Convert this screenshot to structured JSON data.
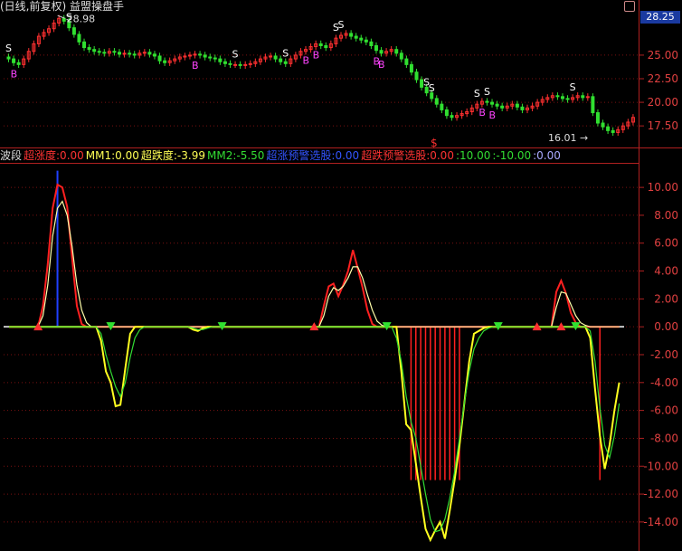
{
  "window": {
    "title": "(日线,前复权) 益盟操盘手",
    "current_price": "28.25",
    "upper_annotations": {
      "high_price": "28.98",
      "low_price": "16.01 →",
      "red_marker": "$"
    },
    "lower_labels": [
      {
        "text": "波段",
        "color": "#dddddd"
      },
      {
        "text": "超涨度:0.00",
        "color": "#ff3333"
      },
      {
        "text": "MM1:0.00",
        "color": "#ffff55"
      },
      {
        "text": "超跌度:-3.99",
        "color": "#ffff55"
      },
      {
        "text": "MM2:-5.50",
        "color": "#33dd33"
      },
      {
        "text": "超涨预警选股:0.00",
        "color": "#3355ff"
      },
      {
        "text": "超跌预警选股:0.00",
        "color": "#ff3333"
      },
      {
        "text": ":10.00",
        "color": "#33dd33"
      },
      {
        "text": ":-10.00",
        "color": "#33dd33"
      },
      {
        "text": ":0.00",
        "color": "#aaaaff"
      }
    ]
  },
  "chart_data": [
    {
      "type": "candlestick",
      "title": "(日线,前复权) 益盟操盘手",
      "y_ticks": [
        "25.00",
        "22.50",
        "20.00",
        "17.50"
      ],
      "ylim": [
        15.5,
        29.5
      ],
      "closes": [
        24.6,
        24.2,
        24.0,
        24.6,
        25.4,
        26.2,
        27.0,
        27.4,
        27.8,
        28.4,
        28.9,
        28.6,
        27.9,
        27.2,
        26.4,
        25.8,
        25.6,
        25.4,
        25.3,
        25.2,
        25.4,
        25.3,
        25.1,
        25.2,
        25.1,
        25.0,
        25.2,
        25.3,
        25.1,
        24.9,
        24.4,
        24.2,
        24.4,
        24.6,
        24.8,
        24.9,
        25.0,
        25.1,
        25.0,
        24.8,
        24.7,
        24.6,
        24.3,
        24.1,
        24.0,
        24.0,
        23.9,
        24.0,
        24.1,
        24.3,
        24.6,
        24.8,
        24.9,
        24.6,
        24.3,
        24.1,
        24.6,
        25.0,
        25.4,
        25.6,
        25.9,
        26.2,
        26.0,
        25.8,
        26.2,
        26.8,
        27.1,
        27.3,
        27.0,
        26.8,
        26.6,
        26.4,
        26.0,
        25.5,
        25.2,
        25.4,
        25.6,
        25.2,
        24.6,
        24.0,
        23.2,
        22.4,
        21.6,
        21.0,
        20.4,
        19.8,
        19.2,
        18.6,
        18.4,
        18.6,
        18.8,
        19.0,
        19.4,
        19.8,
        20.1,
        20.0,
        19.8,
        19.6,
        19.4,
        19.6,
        19.8,
        19.5,
        19.2,
        19.4,
        19.6,
        20.0,
        20.3,
        20.5,
        20.7,
        20.6,
        20.4,
        20.3,
        20.5,
        20.7,
        20.5,
        20.6,
        18.9,
        17.8,
        17.4,
        17.0,
        16.8,
        17.1,
        17.5,
        17.9,
        18.4
      ],
      "signals_S": [
        "S",
        "S",
        "S",
        "S",
        "S",
        "S",
        "S",
        "S",
        "S",
        "S",
        "S"
      ],
      "signals_B": [
        "B",
        "B",
        "B",
        "B",
        "B",
        "B",
        "B",
        "B"
      ]
    },
    {
      "type": "line",
      "title": "波段",
      "y_ticks": [
        "10.00",
        "8.00",
        "6.00",
        "4.00",
        "2.00",
        "0.00",
        "-2.00",
        "-4.00",
        "-6.00",
        "-8.00",
        "-10.00",
        "-12.00",
        "-14.00"
      ],
      "ylim": [
        -15.5,
        11.5
      ],
      "series": [
        {
          "name": "超涨度",
          "color": "#ff2020",
          "values": [
            0,
            0,
            0,
            0,
            0,
            0,
            0,
            1.5,
            4.5,
            8.5,
            10.2,
            10.0,
            8.6,
            5.0,
            1.5,
            0.2,
            0,
            0,
            0,
            0,
            0,
            0,
            0,
            0,
            0,
            0,
            0,
            0,
            0,
            0,
            0,
            0,
            0,
            0,
            0,
            0,
            0,
            0,
            0,
            0,
            0,
            0,
            0,
            0,
            0,
            0,
            0,
            0,
            0,
            0,
            0,
            0,
            0,
            0,
            0,
            0,
            0,
            0,
            0,
            0,
            0,
            0,
            0,
            0,
            0,
            1.5,
            2.9,
            3.1,
            2.2,
            3.0,
            4.0,
            5.5,
            4.2,
            2.8,
            1.2,
            0.2,
            0,
            0,
            0,
            0,
            0,
            0,
            0,
            0,
            0,
            0,
            0,
            0,
            0,
            0,
            0,
            0,
            0,
            0,
            0,
            0,
            0,
            0,
            0,
            0,
            0,
            0,
            0,
            0,
            0,
            0,
            0,
            0,
            0,
            0,
            0,
            0,
            0,
            2.5,
            3.3,
            2.4,
            1.0,
            0.3,
            0,
            0,
            0,
            0,
            0,
            0,
            0,
            0,
            0
          ]
        },
        {
          "name": "MM1",
          "color": "#ffffaa",
          "values": [
            0,
            0,
            0,
            0,
            0,
            0,
            0,
            0.8,
            3.0,
            6.5,
            8.5,
            9.0,
            8.0,
            5.8,
            3.0,
            1.2,
            0.3,
            0,
            0,
            0,
            0,
            0,
            0,
            0,
            0,
            0,
            0,
            0,
            0,
            0,
            0,
            0,
            0,
            0,
            0,
            0,
            0,
            0,
            0,
            0,
            0,
            0,
            0,
            0,
            0,
            0,
            0,
            0,
            0,
            0,
            0,
            0,
            0,
            0,
            0,
            0,
            0,
            0,
            0,
            0,
            0,
            0,
            0,
            0,
            0,
            0.8,
            2.2,
            2.8,
            2.6,
            2.9,
            3.5,
            4.3,
            4.3,
            3.5,
            2.3,
            1.2,
            0.4,
            0.1,
            0,
            0,
            0,
            0,
            0,
            0,
            0,
            0,
            0,
            0,
            0,
            0,
            0,
            0,
            0,
            0,
            0,
            0,
            0,
            0,
            0,
            0,
            0,
            0,
            0,
            0,
            0,
            0,
            0,
            0,
            0,
            0,
            0,
            0,
            0,
            1.4,
            2.5,
            2.4,
            1.6,
            0.8,
            0.3,
            0.1,
            0,
            0,
            0,
            0,
            0,
            0,
            0
          ]
        },
        {
          "name": "超跌度",
          "color": "#ffff20",
          "values": [
            0,
            0,
            0,
            0,
            0,
            0,
            0,
            0,
            0,
            0,
            0,
            0,
            0,
            0,
            0,
            0,
            0,
            0,
            0,
            -1.0,
            -3.2,
            -4.0,
            -5.7,
            -5.6,
            -3.0,
            -0.5,
            0,
            0,
            0,
            0,
            0,
            0,
            0,
            0,
            0,
            0,
            0,
            0,
            -0.2,
            -0.3,
            -0.1,
            0,
            0,
            0,
            0,
            0,
            0,
            0,
            0,
            0,
            0,
            0,
            0,
            0,
            0,
            0,
            0,
            0,
            0,
            0,
            0,
            0,
            0,
            0,
            0,
            0,
            0,
            0,
            0,
            0,
            0,
            0,
            0,
            0,
            0,
            0,
            0,
            0,
            0,
            0,
            0,
            -3.2,
            -7.0,
            -7.4,
            -9.8,
            -12.2,
            -14.5,
            -15.3,
            -14.6,
            -14.0,
            -15.2,
            -13.2,
            -11.0,
            -8.5,
            -5.5,
            -2.5,
            -0.5,
            -0.3,
            -0.1,
            0,
            0,
            0,
            0,
            0,
            0,
            0,
            0,
            0,
            0,
            0,
            0,
            0,
            0,
            0,
            0,
            0,
            0,
            0,
            0,
            0,
            -0.8,
            -4.5,
            -7.8,
            -10.2,
            -8.5,
            -6.0,
            -4.0
          ]
        },
        {
          "name": "MM2",
          "color": "#33dd33",
          "values": [
            0,
            0,
            0,
            0,
            0,
            0,
            0,
            0,
            0,
            0,
            0,
            0,
            0,
            0,
            0,
            0,
            0,
            0,
            0,
            -0.5,
            -2.0,
            -3.2,
            -4.3,
            -5.0,
            -4.0,
            -2.2,
            -0.8,
            -0.2,
            0,
            0,
            0,
            0,
            0,
            0,
            0,
            0,
            0,
            0,
            -0.1,
            -0.2,
            -0.2,
            -0.1,
            0,
            0,
            0,
            0,
            0,
            0,
            0,
            0,
            0,
            0,
            0,
            0,
            0,
            0,
            0,
            0,
            0,
            0,
            0,
            0,
            0,
            0,
            0,
            0,
            0,
            0,
            0,
            0,
            0,
            0,
            0,
            0,
            0,
            0,
            0,
            0,
            0,
            0,
            -0.8,
            -2.5,
            -5.0,
            -6.8,
            -8.0,
            -10.0,
            -12.0,
            -13.8,
            -14.7,
            -14.6,
            -13.8,
            -12.3,
            -10.4,
            -8.0,
            -5.5,
            -3.2,
            -1.6,
            -0.8,
            -0.3,
            -0.1,
            0,
            0,
            0,
            0,
            0,
            0,
            0,
            0,
            0,
            0,
            0,
            0,
            0,
            0,
            0,
            0,
            0,
            0,
            0,
            0,
            -0.3,
            -2.5,
            -5.8,
            -8.5,
            -9.4,
            -7.8,
            -5.5
          ]
        }
      ],
      "hlines": [
        10,
        -10,
        0
      ]
    }
  ]
}
